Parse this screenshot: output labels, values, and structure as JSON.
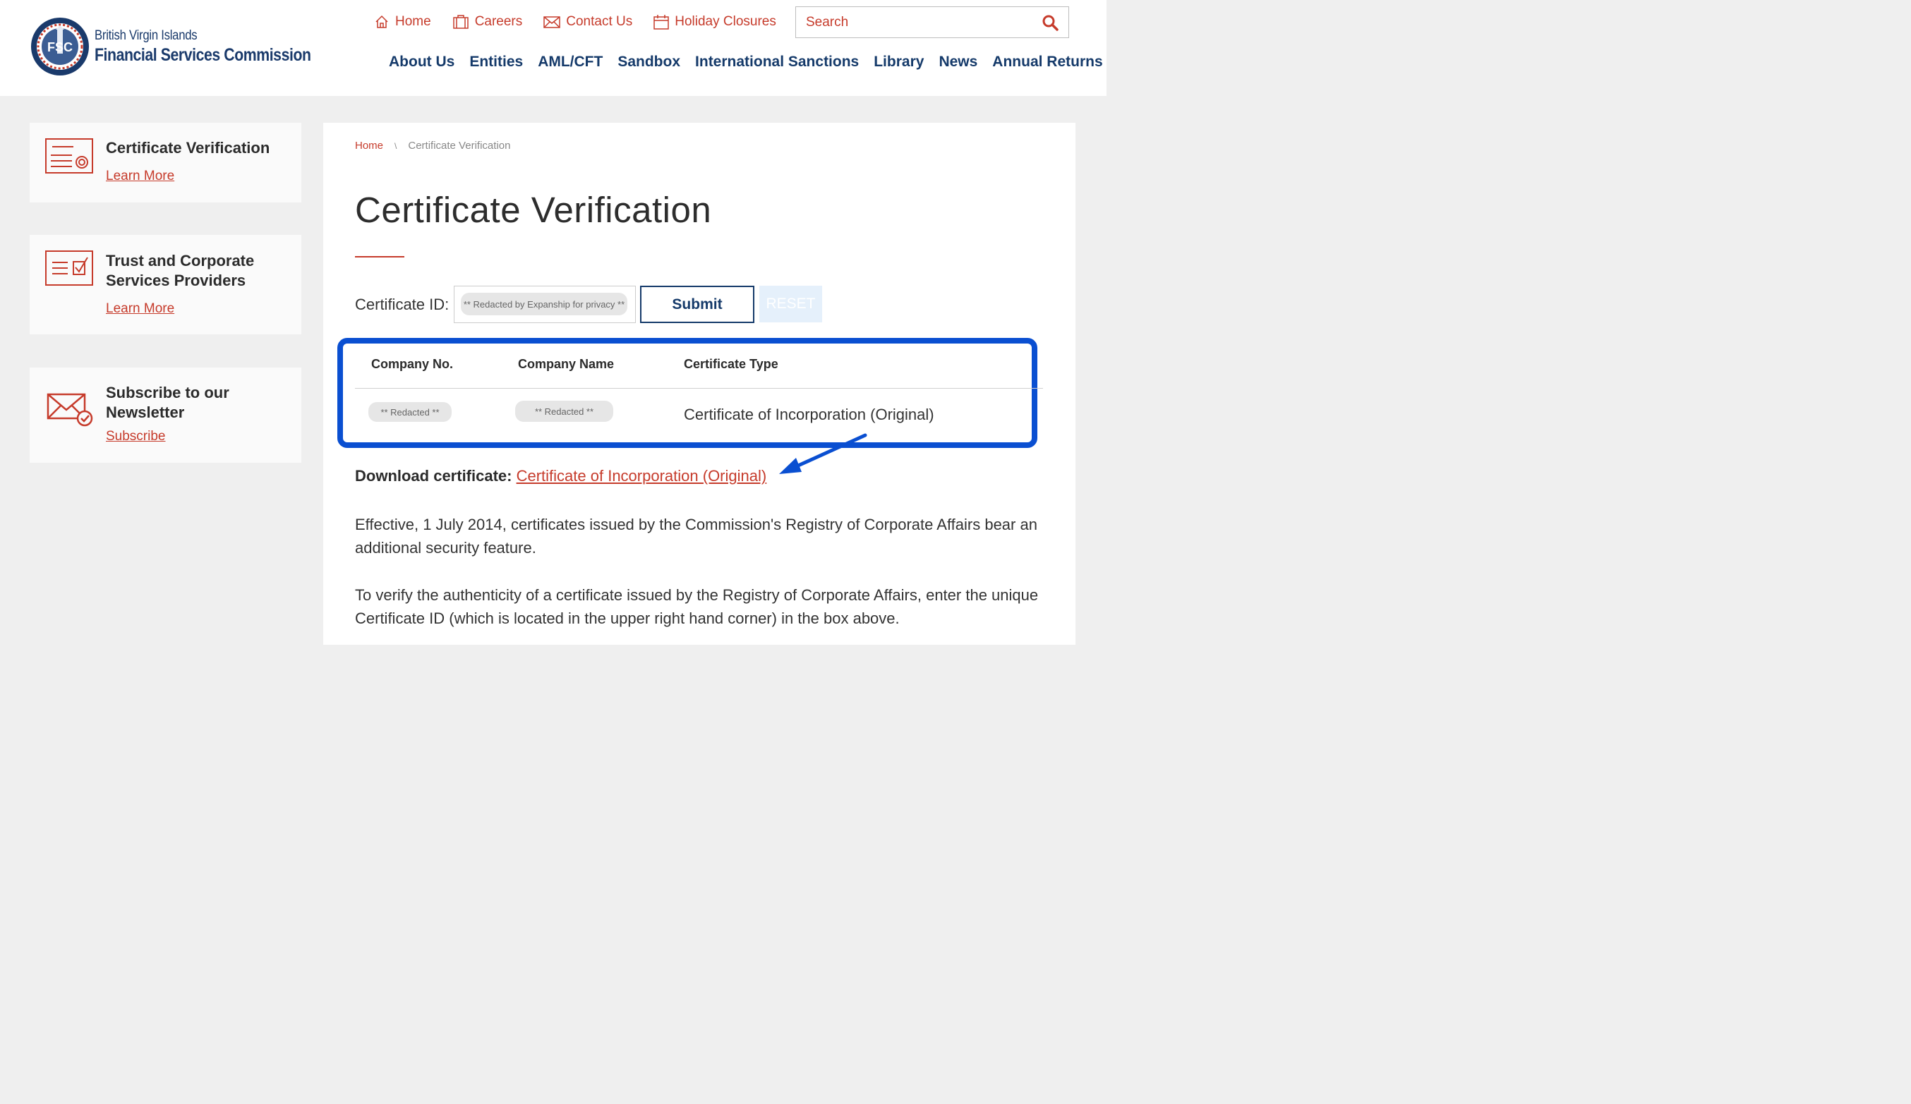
{
  "header": {
    "logo_line1": "British Virgin Islands",
    "logo_line2": "Financial Services Commission",
    "logo_badge": "FSC",
    "utility_nav": [
      {
        "label": "Home",
        "icon": "home-icon"
      },
      {
        "label": "Careers",
        "icon": "briefcase-icon"
      },
      {
        "label": "Contact Us",
        "icon": "envelope-icon"
      },
      {
        "label": "Holiday Closures",
        "icon": "calendar-icon"
      }
    ],
    "search_placeholder": "Search",
    "main_nav": [
      "About Us",
      "Entities",
      "AML/CFT",
      "Sandbox",
      "International Sanctions",
      "Library",
      "News",
      "Annual Returns"
    ]
  },
  "sidebar": {
    "cards": [
      {
        "title": "Certificate Verification",
        "link": "Learn More",
        "icon": "certificate-icon"
      },
      {
        "title": "Trust and Corporate Services Providers",
        "link": "Learn More",
        "icon": "checklist-icon"
      },
      {
        "title": "Subscribe to our Newsletter",
        "link": "Subscribe",
        "icon": "mail-check-icon"
      }
    ]
  },
  "main": {
    "breadcrumb": {
      "home": "Home",
      "separator": "\\",
      "current": "Certificate Verification"
    },
    "title": "Certificate Verification",
    "form": {
      "label": "Certificate ID:",
      "value": "** Redacted by Expanship for privacy **",
      "submit": "Submit",
      "reset": "RESET"
    },
    "table": {
      "headers": [
        "Company No.",
        "Company Name",
        "Certificate Type"
      ],
      "row": {
        "company_no": "** Redacted **",
        "company_name": "** Redacted **",
        "certificate_type": "Certificate of Incorporation (Original)"
      }
    },
    "download": {
      "label": "Download certificate:",
      "link": "Certificate of Incorporation (Original)"
    },
    "paragraphs": [
      "Effective, 1 July 2014, certificates issued by the Commission's Registry of Corporate Affairs bear an additional security feature.",
      "To verify the authenticity of a certificate issued by the Registry of Corporate Affairs, enter the unique Certificate ID (which is located in the upper right hand corner) in the box above."
    ]
  },
  "colors": {
    "accent_red": "#c63b2b",
    "navy": "#153a6a",
    "highlight_blue": "#0a4fd1",
    "background": "#efefef"
  }
}
